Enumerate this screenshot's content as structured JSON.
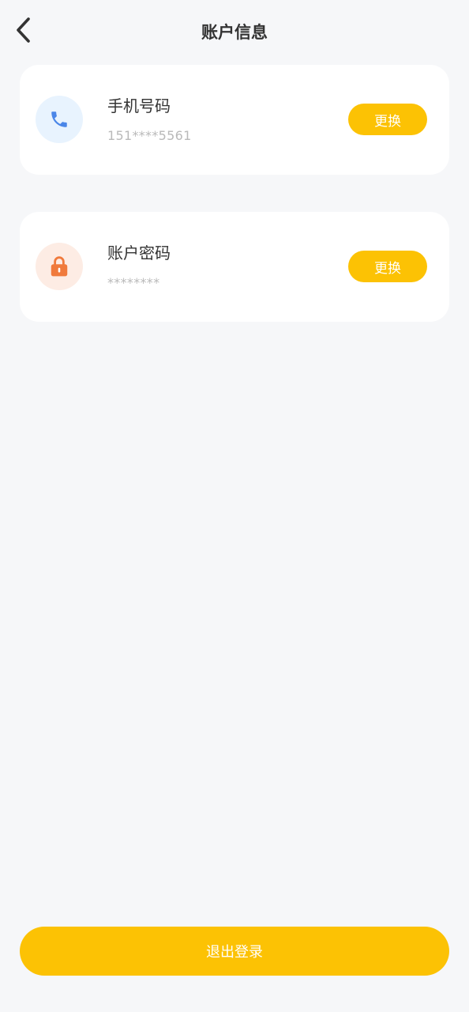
{
  "header": {
    "title": "账户信息",
    "back_icon": "chevron-left-icon"
  },
  "cards": [
    {
      "label": "手机号码",
      "value": "151****5561",
      "button_label": "更换",
      "icon": "phone-icon",
      "icon_color": "#4a86e8",
      "icon_bg": "#e8f3fe"
    },
    {
      "label": "账户密码",
      "value": "********",
      "button_label": "更换",
      "icon": "lock-icon",
      "icon_color": "#f07a3c",
      "icon_bg": "#fdece4"
    }
  ],
  "logout": {
    "label": "退出登录"
  },
  "colors": {
    "accent": "#fcc204",
    "background": "#f6f7f9",
    "card": "#ffffff"
  }
}
